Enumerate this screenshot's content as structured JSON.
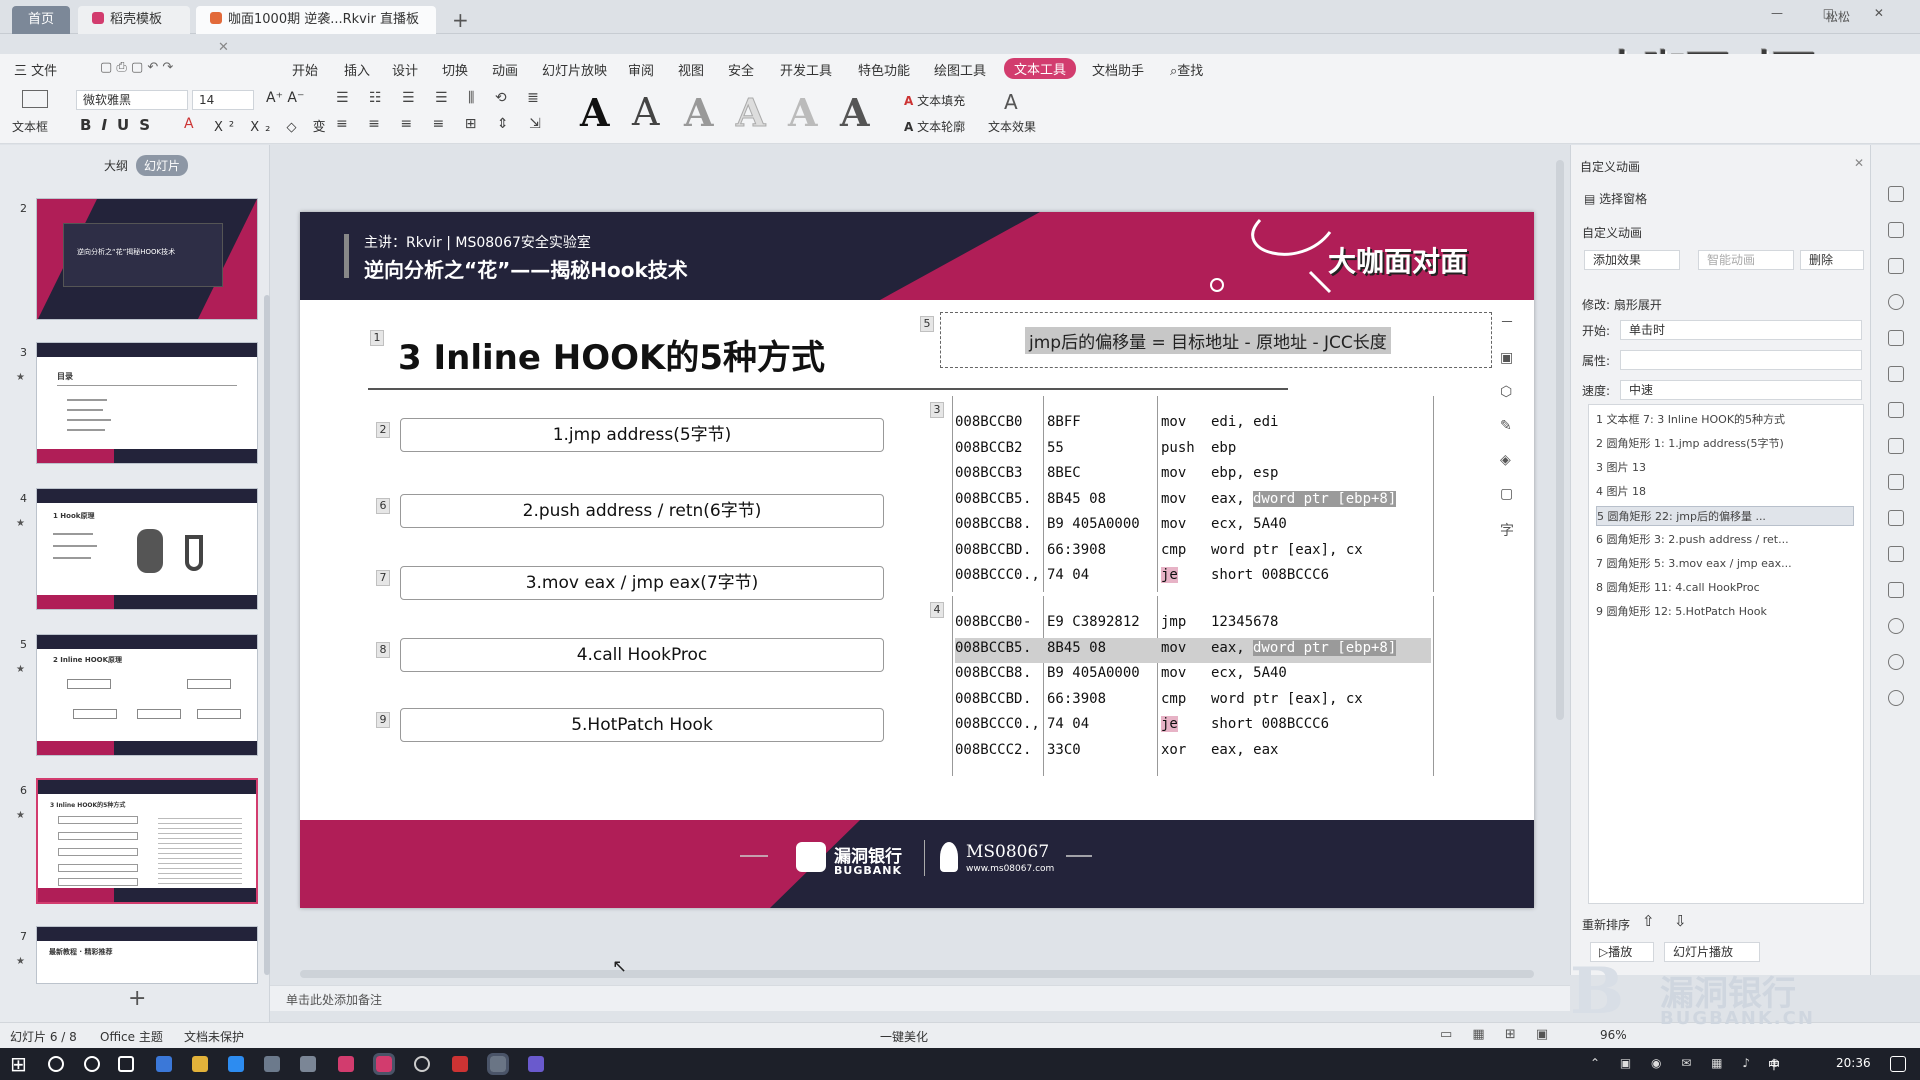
{
  "titlebar": {
    "home_tab": "首页",
    "tabs": [
      "稻壳模板",
      "咖面1000期 逆袭...Rkvir 直播板"
    ],
    "brand_overlay": "大咖面对面",
    "window_controls": "— □ ✕",
    "user": "松松"
  },
  "menubar": {
    "file": "三 文件",
    "items": [
      "开始",
      "插入",
      "设计",
      "切换",
      "动画",
      "幻灯片放映",
      "审阅",
      "视图",
      "安全",
      "开发工具",
      "特色功能",
      "绘图工具",
      "文本工具",
      "文档助手",
      "查找"
    ],
    "active": "文本工具"
  },
  "ribbon": {
    "textbox_label": "文本框",
    "font_name": "微软雅黑",
    "font_size": "14",
    "text_fill": "文本填充",
    "text_outline": "文本轮廓",
    "text_effect": "文本效果",
    "big_letters": [
      "A",
      "A",
      "A",
      "A",
      "A",
      "A"
    ]
  },
  "leftpanel": {
    "outline_tab": "大纲",
    "slides_tab": "幻灯片",
    "slide_numbers": [
      "2",
      "3",
      "4",
      "5",
      "6",
      "7"
    ],
    "thumb2_title": "逆向分析之“花”揭秘HOOK技术",
    "thumb3_title": "目录",
    "thumb4_title": "1 Hook原理",
    "thumb5_title": "2 Inline HOOK原理",
    "thumb6_title": "3 Inline HOOK的5种方式",
    "thumb7_title": "最新教程 · 精彩推荐",
    "add_slide": "+"
  },
  "slide": {
    "speaker": "主讲：Rkvir | MS08067安全实验室",
    "course_title": "逆向分析之“花”——揭秘Hook技术",
    "brand": "大咖面对面",
    "heading": "3 Inline HOOK的5种方式",
    "formula": "jmp后的偏移量 = 目标地址 - 原地址 - JCC长度",
    "tags": {
      "heading": "1",
      "formula": "5",
      "code1": "3",
      "code2": "4",
      "m1": "2",
      "m2": "6",
      "m3": "7",
      "m4": "8",
      "m5": "9"
    },
    "methods": [
      "1.jmp address(5字节)",
      "2.push address / retn(6字节)",
      "3.mov eax / jmp eax(7字节)",
      "4.call HookProc",
      "5.HotPatch Hook"
    ],
    "code_block_1": [
      {
        "addr": "008BCCB0",
        "mark": " ",
        "bytes": "8BFF",
        "op": "mov",
        "args": "edi, edi",
        "hl": ""
      },
      {
        "addr": "008BCCB2",
        "mark": " ",
        "bytes": "55",
        "op": "push",
        "args": "ebp",
        "hl": ""
      },
      {
        "addr": "008BCCB3",
        "mark": " ",
        "bytes": "8BEC",
        "op": "mov",
        "args": "ebp, esp",
        "hl": ""
      },
      {
        "addr": "008BCCB5",
        "mark": ".",
        "bytes": "8B45 08",
        "op": "mov",
        "args": "eax, ",
        "hl": "dword ptr [ebp+8]"
      },
      {
        "addr": "008BCCB8",
        "mark": ".",
        "bytes": "B9 405A0000",
        "op": "mov",
        "args": "ecx, 5A40",
        "hl": ""
      },
      {
        "addr": "008BCCBD",
        "mark": ".",
        "bytes": "66:3908",
        "op": "cmp",
        "args": "word ptr [eax], cx",
        "hl": ""
      },
      {
        "addr": "008BCCC0",
        "mark": ".,",
        "bytes": "74 04",
        "op": "je",
        "args": "short 008BCCC6",
        "hl": ""
      }
    ],
    "code_block_2": [
      {
        "addr": "008BCCB0",
        "mark": "-",
        "bytes": "E9 C3892812",
        "op": "jmp",
        "args": "12345678",
        "hl": ""
      },
      {
        "addr": "008BCCB5",
        "mark": ".",
        "bytes": "8B45 08",
        "op": "mov",
        "args": "eax, ",
        "hl": "dword ptr [ebp+8]"
      },
      {
        "addr": "008BCCB8",
        "mark": ".",
        "bytes": "B9 405A0000",
        "op": "mov",
        "args": "ecx, 5A40",
        "hl": ""
      },
      {
        "addr": "008BCCBD",
        "mark": ".",
        "bytes": "66:3908",
        "op": "cmp",
        "args": "word ptr [eax], cx",
        "hl": ""
      },
      {
        "addr": "008BCCC0",
        "mark": ".,",
        "bytes": "74 04",
        "op": "je",
        "args": "short 008BCCC6",
        "hl": ""
      },
      {
        "addr": "008BCCC2",
        "mark": ".",
        "bytes": "33C0",
        "op": "xor",
        "args": "eax, eax",
        "hl": ""
      }
    ],
    "footer_logo1": "漏洞银行",
    "footer_logo1_sub": "BUGBANK",
    "footer_logo2": "MS08067",
    "footer_logo2_sub": "www.ms08067.com"
  },
  "rightpanel": {
    "header": "自定义动画",
    "select_pane": "选择窗格",
    "section": "自定义动画",
    "add_effect": "添加效果",
    "smart_anim": "智能动画",
    "delete": "删除",
    "modify": "修改: 扇形展开",
    "start_label": "开始:",
    "start_value": "单击时",
    "property_label": "属性:",
    "speed_label": "速度:",
    "speed_value": "中速",
    "anim_items": [
      "1  文本框 7: 3 Inline HOOK的5种方式",
      "2  圆角矩形 1: 1.jmp address(5字节)",
      "3  图片 13",
      "4  图片 18",
      "5  圆角矩形 22: jmp后的偏移量 ...",
      "6  圆角矩形 3: 2.push address / ret...",
      "7  圆角矩形 5: 3.mov eax / jmp eax...",
      "8  圆角矩形 11: 4.call HookProc",
      "9  圆角矩形 12: 5.HotPatch Hook"
    ],
    "reorder": "重新排序",
    "play": "播放",
    "slideshow": "幻灯片播放"
  },
  "notes": {
    "placeholder": "单击此处添加备注"
  },
  "status": {
    "slide_info": "幻灯片 6 / 8",
    "theme": "Office 主题",
    "protect": "文档未保护",
    "beautify": "一键美化",
    "zoom": "96%"
  },
  "taskbar": {
    "ime": "中",
    "time": "20:36"
  },
  "watermark": {
    "cn": "漏洞银行",
    "en": "BUGBANK.CN"
  },
  "colors": {
    "accent": "#d23c6e",
    "dark": "#23233a",
    "crimson": "#b01e57"
  }
}
